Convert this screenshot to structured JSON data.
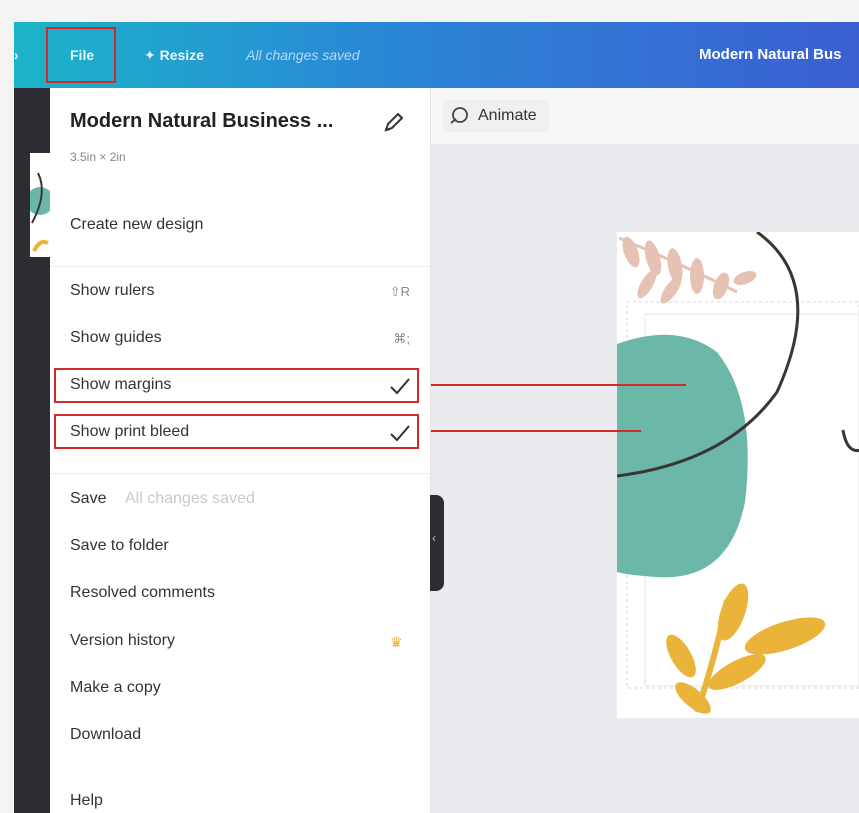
{
  "topbar": {
    "menu_label": "File",
    "resize_label": "Resize",
    "saved_status": "All changes saved",
    "design_title": "Modern Natural Bus",
    "gradient_start": "#1cb4c8",
    "gradient_end": "#3b5fd1"
  },
  "file_menu": {
    "title": "Modern Natural Business ...",
    "dimensions": "3.5in × 2in",
    "items": [
      {
        "label": "Create new design"
      },
      {
        "label": "Show rulers",
        "shortcut": "⇧R"
      },
      {
        "label": "Show guides",
        "shortcut": "⌘;"
      },
      {
        "label": "Show margins",
        "checked": true
      },
      {
        "label": "Show print bleed",
        "checked": true
      },
      {
        "label": "Save",
        "status": "All changes saved"
      },
      {
        "label": "Save to folder"
      },
      {
        "label": "Resolved comments"
      },
      {
        "label": "Version history",
        "icon": "crown-icon"
      },
      {
        "label": "Make a copy"
      },
      {
        "label": "Download"
      },
      {
        "label": "Help"
      }
    ]
  },
  "toolbar": {
    "animate_label": "Animate"
  },
  "annotation_color": "#cf2b2b",
  "palette": {
    "teal": "#6cb8a8",
    "pink": "#e6c2b5",
    "mustard": "#eab43a",
    "line": "#3a3634"
  }
}
